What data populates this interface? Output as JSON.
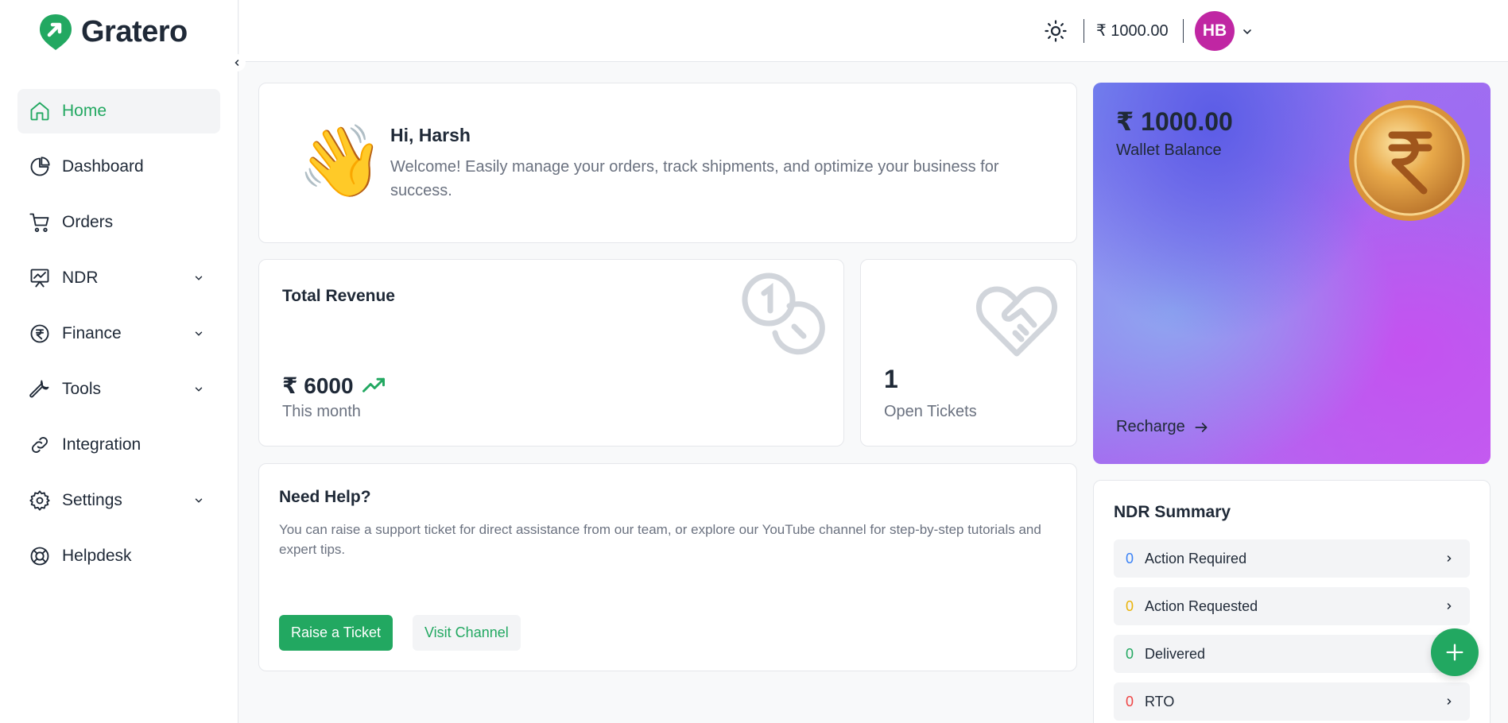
{
  "brand": {
    "name": "Gratero",
    "accent": "#22a861"
  },
  "sidebar": {
    "items": [
      {
        "label": "Home",
        "icon": "home-icon",
        "active": true,
        "expandable": false
      },
      {
        "label": "Dashboard",
        "icon": "pie-chart-icon",
        "active": false,
        "expandable": false
      },
      {
        "label": "Orders",
        "icon": "cart-icon",
        "active": false,
        "expandable": false
      },
      {
        "label": "NDR",
        "icon": "presentation-chart-icon",
        "active": false,
        "expandable": true
      },
      {
        "label": "Finance",
        "icon": "rupee-circle-icon",
        "active": false,
        "expandable": true
      },
      {
        "label": "Tools",
        "icon": "wrench-icon",
        "active": false,
        "expandable": true
      },
      {
        "label": "Integration",
        "icon": "link-icon",
        "active": false,
        "expandable": false
      },
      {
        "label": "Settings",
        "icon": "gear-icon",
        "active": false,
        "expandable": true
      },
      {
        "label": "Helpdesk",
        "icon": "lifebuoy-icon",
        "active": false,
        "expandable": false
      }
    ]
  },
  "topbar": {
    "balance": "₹ 1000.00",
    "avatar_initials": "HB"
  },
  "welcome": {
    "greeting": "Hi, Harsh",
    "message": "Welcome! Easily manage your orders, track shipments, and optimize your business for success."
  },
  "revenue": {
    "title": "Total Revenue",
    "value": "₹ 6000",
    "period": "This month"
  },
  "tickets": {
    "value": "1",
    "label": "Open Tickets"
  },
  "help": {
    "title": "Need Help?",
    "text": "You can raise a support ticket for direct assistance from our team, or explore our YouTube channel for step-by-step tutorials and expert tips.",
    "primary_label": "Raise a Ticket",
    "secondary_label": "Visit Channel"
  },
  "wallet": {
    "amount": "₹ 1000.00",
    "label": "Wallet Balance",
    "recharge_label": "Recharge"
  },
  "ndr_summary": {
    "title": "NDR Summary",
    "rows": [
      {
        "count": "0",
        "label": "Action Required",
        "color": "#3b82f6"
      },
      {
        "count": "0",
        "label": "Action Requested",
        "color": "#eab308"
      },
      {
        "count": "0",
        "label": "Delivered",
        "color": "#22a861"
      },
      {
        "count": "0",
        "label": "RTO",
        "color": "#ef4444"
      }
    ]
  }
}
